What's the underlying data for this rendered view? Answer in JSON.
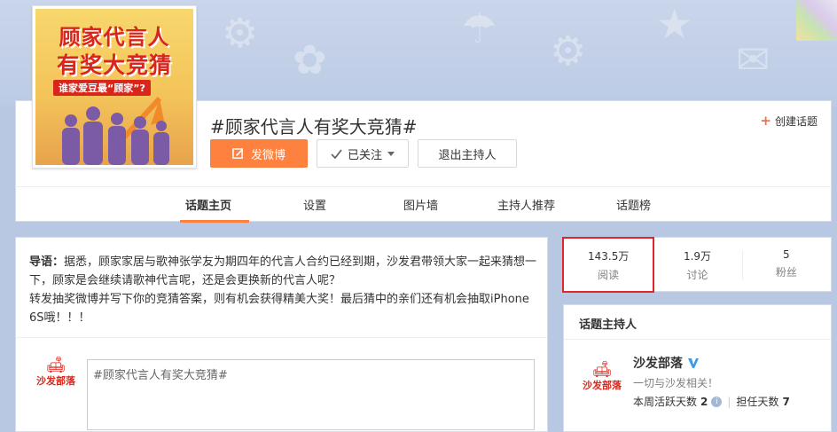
{
  "cover": {
    "line1": "顾家代言人",
    "line2": "有奖大竞猜",
    "line3": "谁家爱豆最“顾家”?"
  },
  "header": {
    "title": "#顾家代言人有奖大竞猜#",
    "create_topic": "创建话题",
    "post_button": "发微博",
    "follow_button": "已关注",
    "exit_host_button": "退出主持人"
  },
  "tabs": [
    {
      "label": "话题主页",
      "active": true
    },
    {
      "label": "设置"
    },
    {
      "label": "图片墙"
    },
    {
      "label": "主持人推荐"
    },
    {
      "label": "话题榜"
    }
  ],
  "intro": {
    "label": "导语：",
    "text1": "据悉，顾家家居与歌神张学友为期四年的代言人合约已经到期，沙发君带领大家一起来猜想一下，顾家是会继续请歌神代言呢，还是会更换新的代言人呢？",
    "text2": "转发抽奖微博并写下你的竞猜答案，则有机会获得精美大奖！最后猜中的亲们还有机会抽取iPhone 6S哦！！！"
  },
  "composer": {
    "logo_text": "沙发部落",
    "prefill": "#顾家代言人有奖大竞猜#"
  },
  "stats": [
    {
      "value": "143.5万",
      "label": "阅读"
    },
    {
      "value": "1.9万",
      "label": "讨论"
    },
    {
      "value": "5",
      "label": "粉丝"
    }
  ],
  "host": {
    "section_title": "话题主持人",
    "logo_text": "沙发部落",
    "name": "沙发部落",
    "bio": "一切与沙发相关！",
    "weekly_label": "本周活跃天数",
    "weekly_value": "2",
    "tenure_label": "担任天数",
    "tenure_value": "7"
  },
  "colors": {
    "accent": "#ff8140",
    "highlight_border": "#e0262b",
    "brand_red": "#d8261d",
    "verify_blue": "#3d9ae8"
  },
  "icons": {
    "post": "edit-icon",
    "follow": "check-icon",
    "dropdown": "caret-down-icon",
    "create": "plus-icon",
    "verify": "verified-v-icon",
    "info": "info-icon"
  }
}
